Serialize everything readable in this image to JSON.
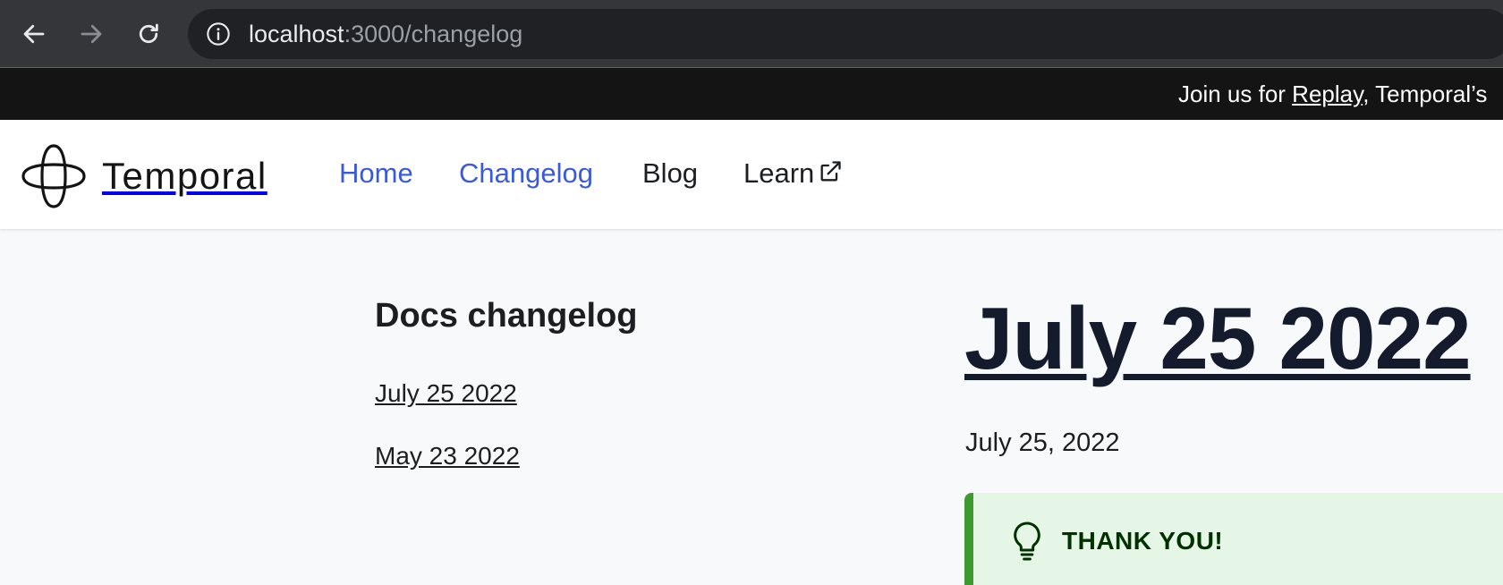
{
  "browser": {
    "url_host": "localhost",
    "url_path": ":3000/changelog"
  },
  "announcement": {
    "prefix": "Join us for ",
    "link": "Replay",
    "suffix": ", Temporal’s"
  },
  "navbar": {
    "brand": "Temporal",
    "items": [
      {
        "label": "Home"
      },
      {
        "label": "Changelog"
      },
      {
        "label": "Blog"
      },
      {
        "label": "Learn"
      }
    ]
  },
  "sidebar": {
    "title": "Docs changelog",
    "items": [
      {
        "label": "July 25 2022"
      },
      {
        "label": "May 23 2022"
      }
    ]
  },
  "post": {
    "title": "July 25 2022",
    "date": "July 25, 2022",
    "admonition_heading": "THANK YOU!"
  },
  "colors": {
    "active_link": "#3a5bd9",
    "announcement_bg": "#141414",
    "admonition_bg": "#e6f6e6",
    "admonition_border": "#3e9a2e"
  },
  "icons": {
    "back": "arrow-left-icon",
    "forward": "arrow-right-icon",
    "reload": "reload-icon",
    "site_info": "info-icon",
    "external": "external-link-icon",
    "admonition": "lightbulb-icon",
    "logo": "temporal-logo-icon"
  }
}
